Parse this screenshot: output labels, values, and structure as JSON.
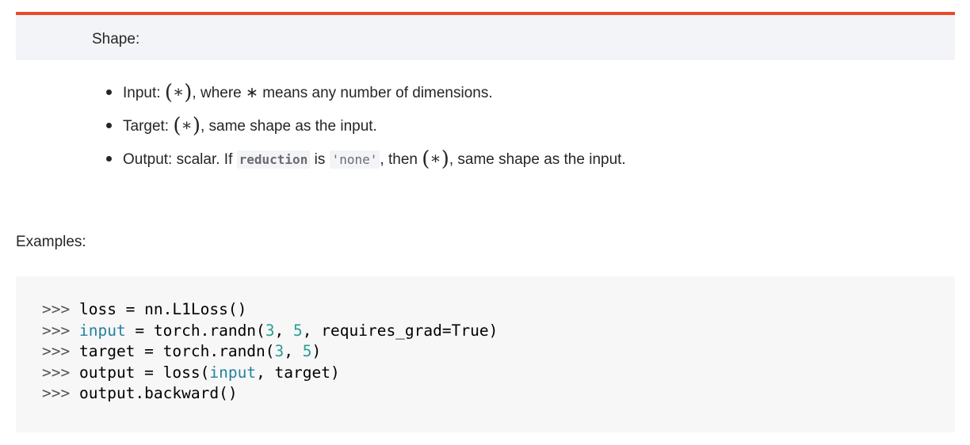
{
  "shape": {
    "title": "Shape:",
    "items": [
      {
        "label": "Input:",
        "math": "∗",
        "text": ", where ∗ means any number of dimensions."
      },
      {
        "label": "Target:",
        "math": "∗",
        "text": ", same shape as the input."
      },
      {
        "label": "Output: scalar. If",
        "code_reduction": "reduction",
        "is_text": "is",
        "code_none": "'none'",
        "then_text": ", then",
        "math": "∗",
        "text": ", same shape as the input."
      }
    ]
  },
  "examples": {
    "label": "Examples:",
    "prompt": ">>>",
    "lines": [
      {
        "a": "loss = nn.L1Loss()"
      },
      {
        "kw": "input",
        "a": " = torch.randn(",
        "n1": "3",
        "b": ", ",
        "n2": "5",
        "c": ", requires_grad=True)"
      },
      {
        "a": "target = torch.randn(",
        "n1": "3",
        "b": ", ",
        "n2": "5",
        "c": ")"
      },
      {
        "a": "output = loss(",
        "kw": "input",
        "b": ", target)"
      },
      {
        "a": "output.backward()"
      }
    ]
  },
  "colors": {
    "accent": "#e44c2c",
    "note_bg": "#f3f4f7",
    "code_bg": "#f7f7f7",
    "keyword": "#2581a0",
    "number": "#2a9d8f"
  }
}
